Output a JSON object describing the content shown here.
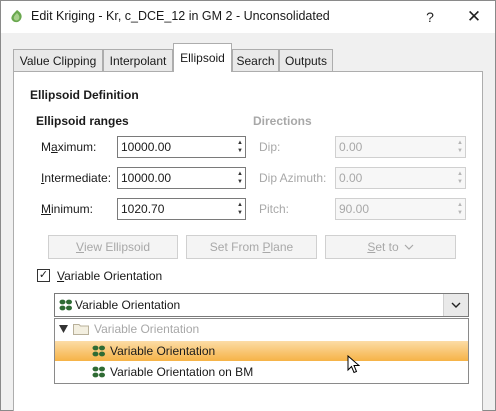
{
  "window": {
    "title": "Edit Kriging - Kr, c_DCE_12 in GM 2 - Unconsolidated",
    "help_label": "?",
    "close_label": "✕"
  },
  "tabs": [
    {
      "label": "Value Clipping",
      "active": false
    },
    {
      "label": "Interpolant",
      "active": false
    },
    {
      "label": "Ellipsoid",
      "active": true
    },
    {
      "label": "Search",
      "active": false
    },
    {
      "label": "Outputs",
      "active": false
    }
  ],
  "ellipsoid": {
    "definition_title": "Ellipsoid Definition",
    "ranges_title": "Ellipsoid ranges",
    "directions_title": "Directions",
    "maximum": {
      "label_pre": "M",
      "label_u": "a",
      "label_post": "ximum:",
      "value": "10000.00"
    },
    "intermediate": {
      "label_pre": "",
      "label_u": "I",
      "label_post": "ntermediate:",
      "value": "10000.00"
    },
    "minimum": {
      "label_pre": "",
      "label_u": "M",
      "label_post": "inimum:",
      "value": "1020.70"
    },
    "dip": {
      "label": "Dip:",
      "value": "0.00"
    },
    "dip_azimuth": {
      "label": "Dip Azimuth:",
      "value": "0.00"
    },
    "pitch": {
      "label": "Pitch:",
      "value": "90.00"
    },
    "buttons": {
      "view_ellipsoid": {
        "pre": "",
        "u": "V",
        "post": "iew Ellipsoid"
      },
      "set_from_plane": {
        "pre": "Set From ",
        "u": "P",
        "post": "lane"
      },
      "set_to": {
        "pre": "",
        "u": "S",
        "post": "et to"
      }
    }
  },
  "variable_orientation": {
    "checkbox": {
      "checked": true,
      "label_pre": "",
      "label_u": "V",
      "label_post": "ariable Orientation",
      "check_glyph": "✓"
    },
    "selected": "Variable Orientation",
    "tree": {
      "folder": "Variable Orientation",
      "items": [
        {
          "label": "Variable Orientation",
          "selected": true
        },
        {
          "label": "Variable Orientation on BM",
          "selected": false
        }
      ]
    }
  },
  "colors": {
    "accent": "#f6b347",
    "selection_light": "#fcdca6",
    "disabled_text": "#a8a8a8",
    "vo_icon_green": "#2f6b34"
  }
}
